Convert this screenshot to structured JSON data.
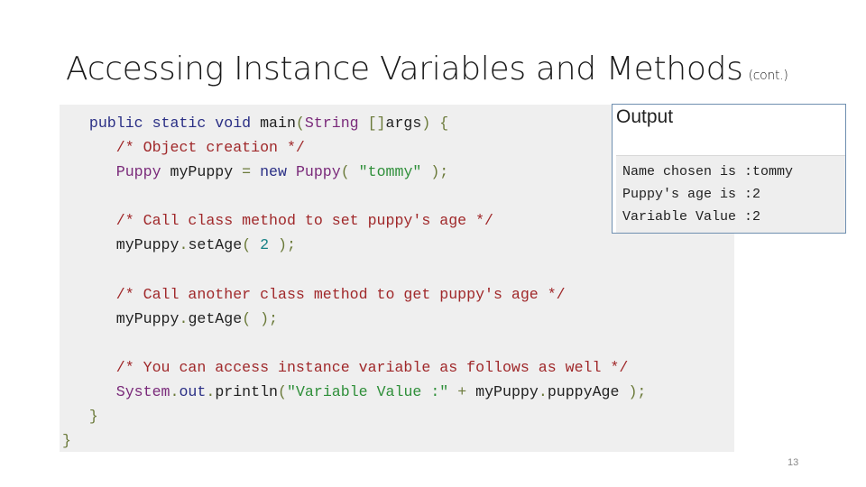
{
  "slide": {
    "title": "Accessing Instance Variables and Methods",
    "title_suffix": "(cont.)",
    "page_number": "13"
  },
  "code": {
    "lines": [
      [
        {
          "t": "   "
        },
        {
          "t": "public static void ",
          "c": "kw"
        },
        {
          "t": "main",
          "c": "fn"
        },
        {
          "t": "(",
          "c": "pn"
        },
        {
          "t": "String",
          "c": "ty"
        },
        {
          "t": " []",
          "c": "pn"
        },
        {
          "t": "args",
          "c": "fn"
        },
        {
          "t": ") {",
          "c": "pn"
        }
      ],
      [
        {
          "t": "      "
        },
        {
          "t": "/* Object creation */",
          "c": "cm"
        }
      ],
      [
        {
          "t": "      "
        },
        {
          "t": "Puppy",
          "c": "ty"
        },
        {
          "t": " myPuppy ",
          "c": "fn"
        },
        {
          "t": "= ",
          "c": "pn"
        },
        {
          "t": "new ",
          "c": "kw"
        },
        {
          "t": "Puppy",
          "c": "ty"
        },
        {
          "t": "( ",
          "c": "pn"
        },
        {
          "t": "\"tommy\"",
          "c": "st"
        },
        {
          "t": " );",
          "c": "pn"
        }
      ],
      [
        {
          "t": ""
        }
      ],
      [
        {
          "t": "      "
        },
        {
          "t": "/* Call class method to set puppy's age */",
          "c": "cm"
        }
      ],
      [
        {
          "t": "      "
        },
        {
          "t": "myPuppy",
          "c": "fn"
        },
        {
          "t": ".",
          "c": "pn"
        },
        {
          "t": "setAge",
          "c": "fn"
        },
        {
          "t": "( ",
          "c": "pn"
        },
        {
          "t": "2",
          "c": "nm"
        },
        {
          "t": " );",
          "c": "pn"
        }
      ],
      [
        {
          "t": ""
        }
      ],
      [
        {
          "t": "      "
        },
        {
          "t": "/* Call another class method to get puppy's age */",
          "c": "cm"
        }
      ],
      [
        {
          "t": "      "
        },
        {
          "t": "myPuppy",
          "c": "fn"
        },
        {
          "t": ".",
          "c": "pn"
        },
        {
          "t": "getAge",
          "c": "fn"
        },
        {
          "t": "( );",
          "c": "pn"
        }
      ],
      [
        {
          "t": ""
        }
      ],
      [
        {
          "t": "      "
        },
        {
          "t": "/* You can access instance variable as follows as well */",
          "c": "cm"
        }
      ],
      [
        {
          "t": "      "
        },
        {
          "t": "System",
          "c": "ty"
        },
        {
          "t": ".",
          "c": "pn"
        },
        {
          "t": "out",
          "c": "kw"
        },
        {
          "t": ".",
          "c": "pn"
        },
        {
          "t": "println",
          "c": "fn"
        },
        {
          "t": "(",
          "c": "pn"
        },
        {
          "t": "\"Variable Value :\"",
          "c": "st"
        },
        {
          "t": " + ",
          "c": "pn"
        },
        {
          "t": "myPuppy",
          "c": "fn"
        },
        {
          "t": ".",
          "c": "pn"
        },
        {
          "t": "puppyAge",
          "c": "fn"
        },
        {
          "t": " );",
          "c": "pn"
        }
      ],
      [
        {
          "t": "   "
        },
        {
          "t": "}",
          "c": "pn"
        }
      ],
      [
        {
          "t": "}",
          "c": "pn"
        }
      ]
    ]
  },
  "output": {
    "header": "Output",
    "lines": [
      "Name chosen is :tommy",
      "Puppy's age is :2",
      "Variable Value :2"
    ]
  },
  "colors": {
    "keyword": "#2a2f85",
    "type": "#7a2a7a",
    "comment": "#a0282a",
    "string": "#2f8f3a",
    "number": "#178085",
    "code_background": "#efefef",
    "output_border": "#6f8fb0"
  }
}
